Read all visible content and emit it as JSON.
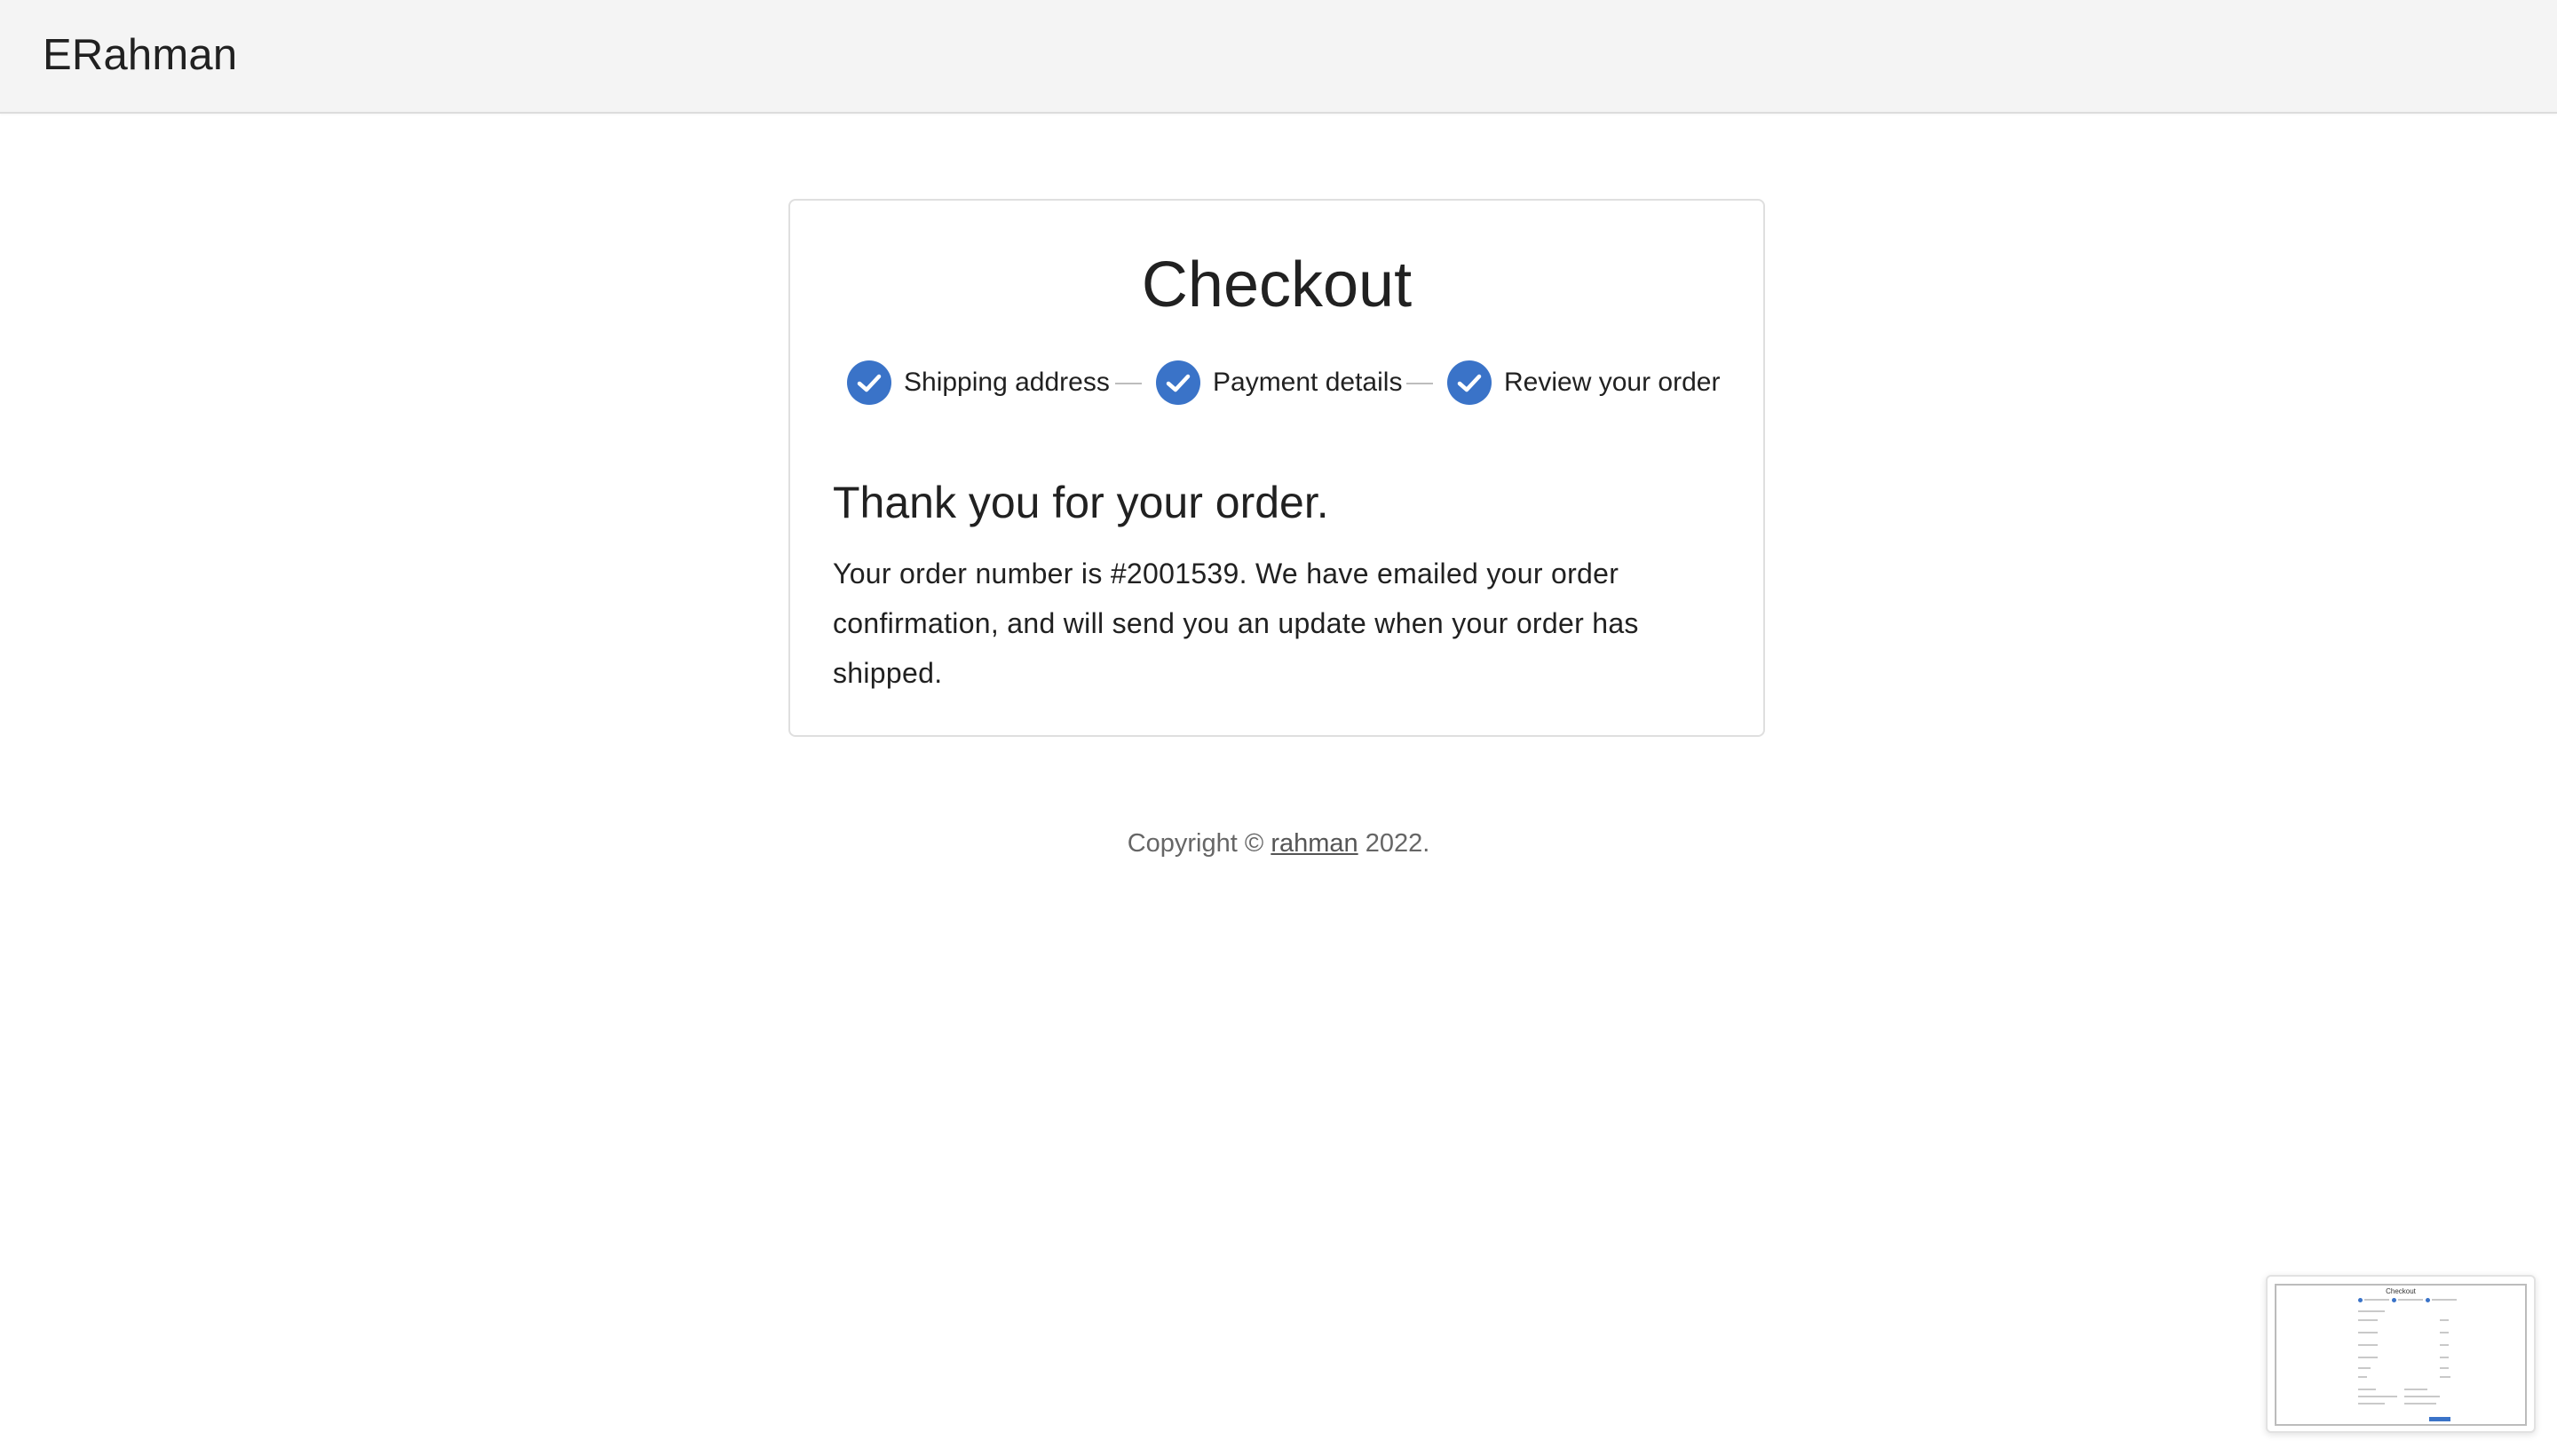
{
  "app": {
    "brand": "ERahman"
  },
  "checkout": {
    "title": "Checkout",
    "steps": [
      {
        "label": "Shipping address",
        "status": "completed",
        "icon": "check-circle-icon"
      },
      {
        "label": "Payment details",
        "status": "completed",
        "icon": "check-circle-icon"
      },
      {
        "label": "Review your order",
        "status": "completed",
        "icon": "check-circle-icon"
      }
    ],
    "heading": "Thank you for your order.",
    "message": "Your order number is #2001539. We have emailed your order confirmation, and will send you an update when your order has shipped."
  },
  "footer": {
    "prefix": "Copyright © ",
    "link_text": "rahman",
    "suffix": " 2022."
  },
  "thumbnail": {
    "title": "Checkout"
  },
  "colors": {
    "accent": "#3a73c8",
    "appbar_bg": "#f4f4f4",
    "text": "#212121",
    "muted": "#666666"
  }
}
